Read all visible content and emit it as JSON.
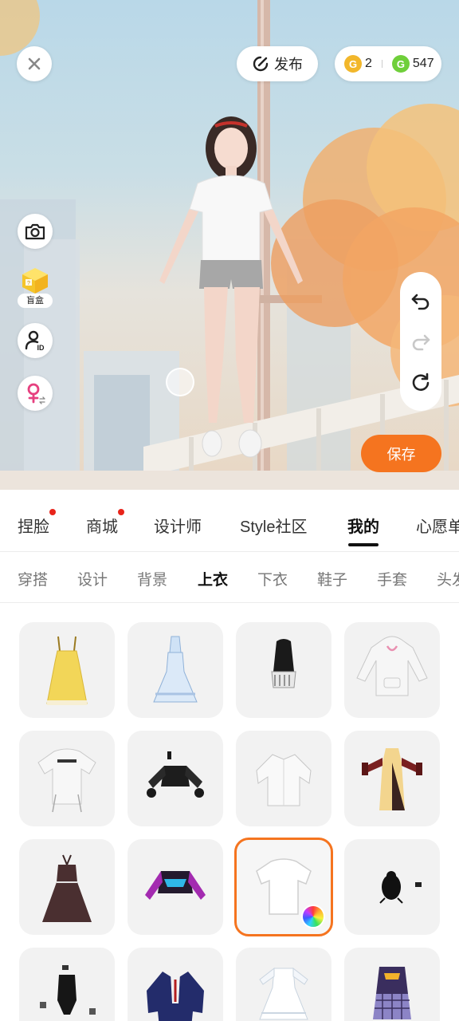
{
  "top_bar": {
    "publish_label": "发布",
    "gold_amount": "2",
    "green_amount": "547"
  },
  "left_tools": {
    "blind_box_label": "盲盒"
  },
  "save_label": "保存",
  "main_tabs": [
    {
      "label": "捏脸",
      "dot": true
    },
    {
      "label": "商城",
      "dot": true
    },
    {
      "label": "设计师",
      "dot": false
    },
    {
      "label": "Style社区",
      "dot": false
    },
    {
      "label": "我的",
      "dot": false,
      "active": true
    },
    {
      "label": "心愿单",
      "dot": false
    }
  ],
  "sub_tabs": [
    {
      "label": "穿搭"
    },
    {
      "label": "设计"
    },
    {
      "label": "背景"
    },
    {
      "label": "上衣",
      "active": true
    },
    {
      "label": "下衣"
    },
    {
      "label": "鞋子"
    },
    {
      "label": "手套"
    },
    {
      "label": "头发"
    }
  ],
  "grid_items": [
    {
      "icon": "yellow-dress-icon"
    },
    {
      "icon": "blue-dress-icon"
    },
    {
      "icon": "black-corset-icon"
    },
    {
      "icon": "white-hoodie-icon"
    },
    {
      "icon": "printed-tshirt-icon"
    },
    {
      "icon": "black-crop-top-icon"
    },
    {
      "icon": "white-shirt-icon"
    },
    {
      "icon": "cheongsam-icon"
    },
    {
      "icon": "dark-dress-icon"
    },
    {
      "icon": "purple-crop-jacket-icon"
    },
    {
      "icon": "white-tshirt-icon",
      "selected": true
    },
    {
      "icon": "black-bow-icon"
    },
    {
      "icon": "black-swimsuit-icon"
    },
    {
      "icon": "blazer-icon"
    },
    {
      "icon": "white-lolita-dress-icon"
    },
    {
      "icon": "purple-plaid-outfit-icon"
    }
  ],
  "colors": {
    "accent": "#f5741f",
    "notification_dot": "#e8241a"
  }
}
